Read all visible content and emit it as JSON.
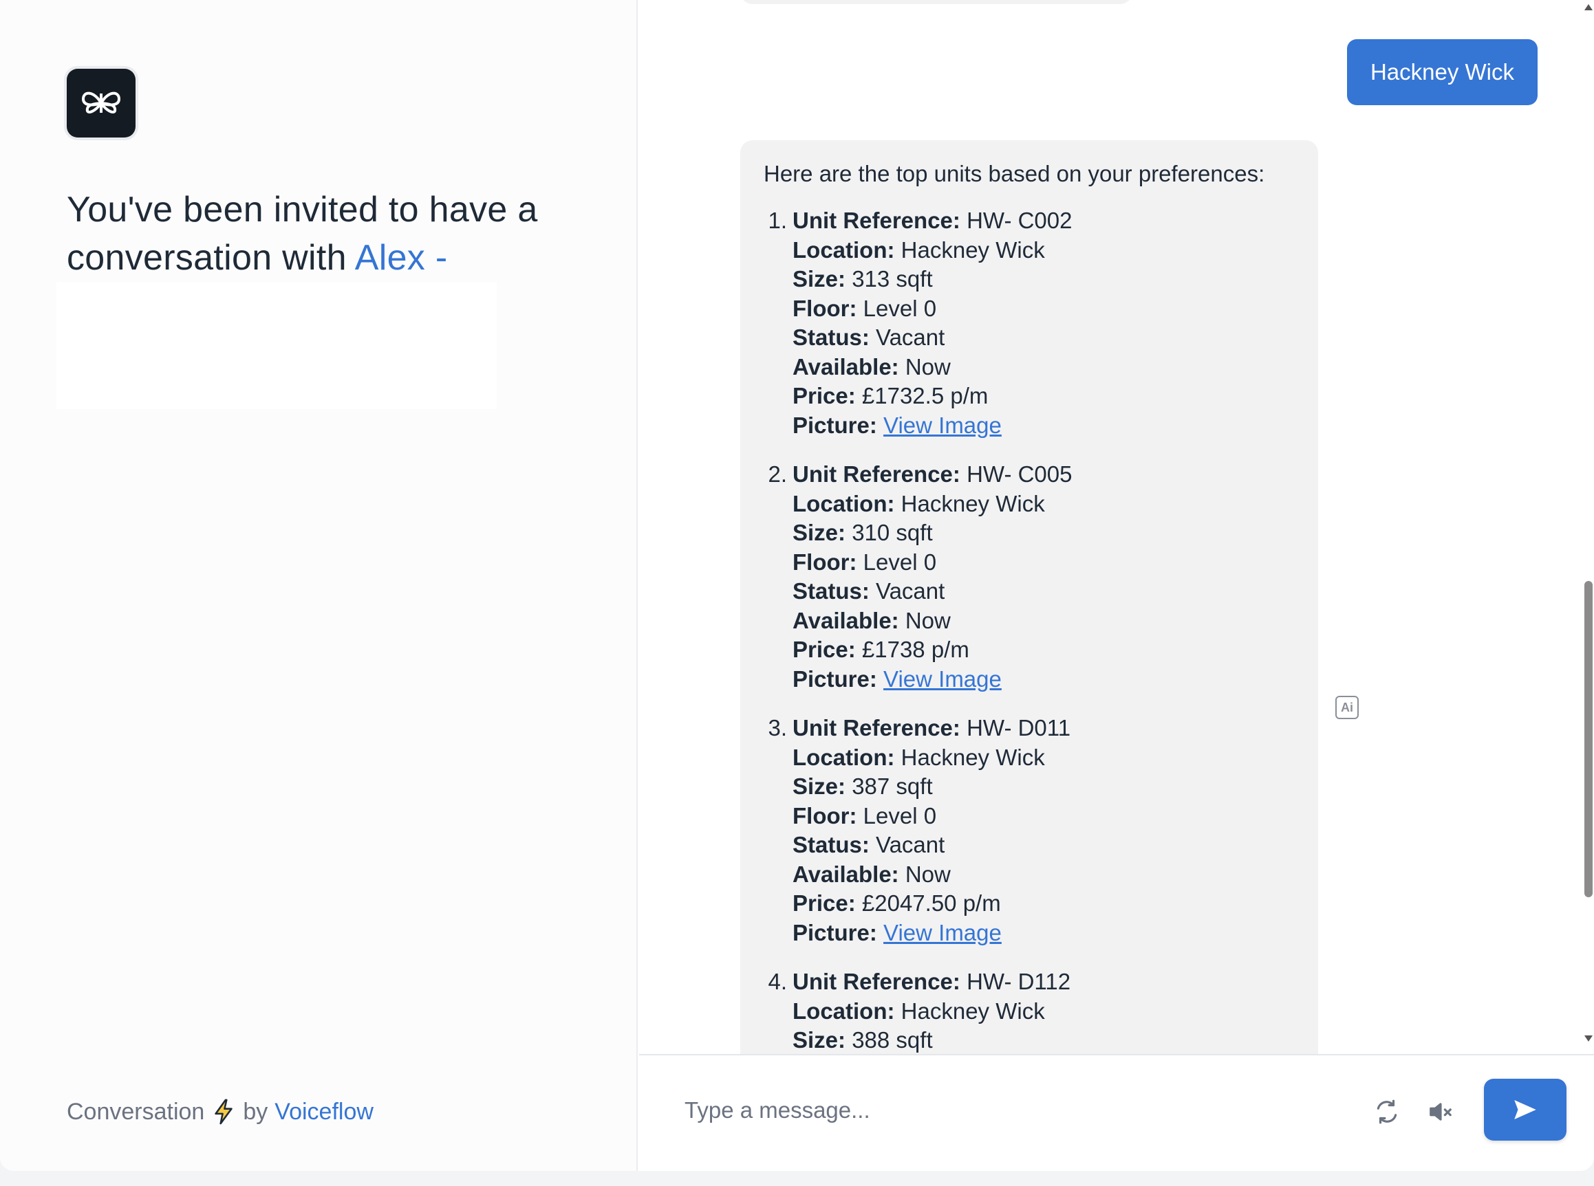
{
  "left_panel": {
    "invite_text": "You've been invited to have a conversation with ",
    "assistant_name": "Alex -",
    "footer": {
      "prefix": "Conversation",
      "by": "by",
      "brand": "Voiceflow"
    }
  },
  "chat": {
    "user_message": "Hackney Wick",
    "bot_intro": "Here are the top units based on your preferences:",
    "field_labels": {
      "unit_reference": "Unit Reference:",
      "location": "Location:",
      "size": "Size:",
      "floor": "Floor:",
      "status": "Status:",
      "available": "Available:",
      "price": "Price:",
      "picture": "Picture:"
    },
    "units": [
      {
        "num": "1.",
        "unit_reference": "HW- C002",
        "location": "Hackney Wick",
        "size": "313 sqft",
        "floor": "Level 0",
        "status": "Vacant",
        "available": "Now",
        "price": "£1732.5 p/m",
        "picture": "View Image"
      },
      {
        "num": "2.",
        "unit_reference": "HW- C005",
        "location": "Hackney Wick",
        "size": "310 sqft",
        "floor": "Level 0",
        "status": "Vacant",
        "available": "Now",
        "price": "£1738 p/m",
        "picture": "View Image"
      },
      {
        "num": "3.",
        "unit_reference": "HW- D011",
        "location": "Hackney Wick",
        "size": "387 sqft",
        "floor": "Level 0",
        "status": "Vacant",
        "available": "Now",
        "price": "£2047.50 p/m",
        "picture": "View Image"
      },
      {
        "num": "4.",
        "unit_reference": "HW- D112",
        "location": "Hackney Wick",
        "size": "388 sqft"
      }
    ],
    "ai_badge": "Ai"
  },
  "input": {
    "placeholder": "Type a message..."
  },
  "colors": {
    "accent": "#3575d4",
    "bubble_bg": "#f2f2f3",
    "logo_bg": "#151b22"
  }
}
